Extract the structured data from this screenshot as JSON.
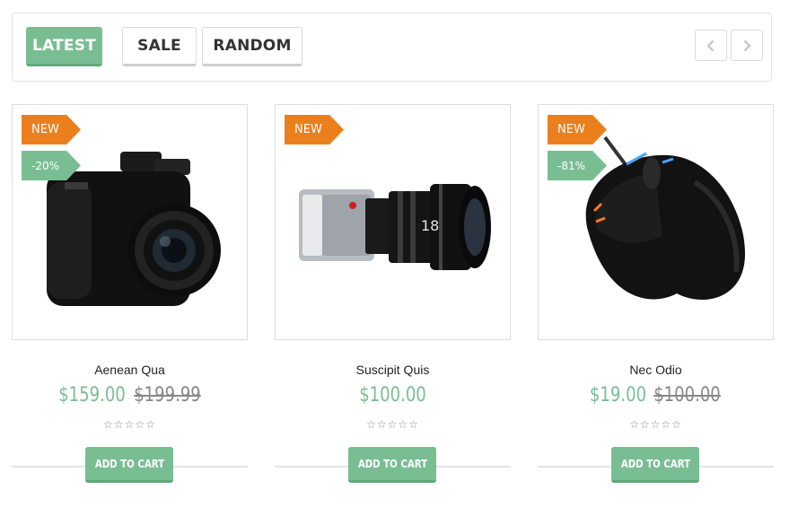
{
  "tabs": [
    {
      "label": "LATEST",
      "active": true
    },
    {
      "label": "SALE",
      "active": false
    },
    {
      "label": "RANDOM",
      "active": false
    }
  ],
  "nav": {
    "prev_icon": "chevron-left-icon",
    "next_icon": "chevron-right-icon"
  },
  "colors": {
    "accent": "#79be93",
    "new_badge": "#ec7f1d"
  },
  "products": [
    {
      "name": "Aenean Qua",
      "price": "$159.00",
      "old_price": "$199.99",
      "badge_new": "NEW",
      "badge_discount": "-20%",
      "rating": 0,
      "image": "camera",
      "cart_label": "ADD TO CART"
    },
    {
      "name": "Suscipit Quis",
      "price": "$100.00",
      "old_price": "",
      "badge_new": "NEW",
      "badge_discount": "",
      "rating": 0,
      "image": "cinema-camera",
      "lens_mark": "18",
      "cart_label": "ADD TO CART"
    },
    {
      "name": "Nec Odio",
      "price": "$19.00",
      "old_price": "$100.00",
      "badge_new": "NEW",
      "badge_discount": "-81%",
      "rating": 0,
      "image": "mouse",
      "cart_label": "ADD TO CART"
    }
  ]
}
